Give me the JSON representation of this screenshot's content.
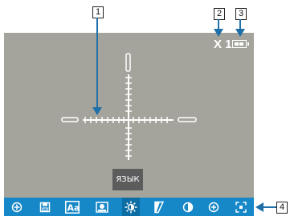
{
  "callouts": {
    "c1": "1",
    "c2": "2",
    "c3": "3",
    "c4": "4"
  },
  "status": {
    "zoom": "X 1"
  },
  "battery": {
    "level_fraction": 1.0,
    "icon": "battery-icon"
  },
  "reticle": {
    "icon": "crosshair-reticle"
  },
  "menu": {
    "active_label": "ЯЗЫК"
  },
  "toolbar": {
    "items": [
      {
        "icon": "target-icon"
      },
      {
        "icon": "save-icon"
      },
      {
        "icon": "font-icon"
      },
      {
        "icon": "picture-icon"
      },
      {
        "icon": "brightness-icon",
        "active": true
      },
      {
        "icon": "contrast-icon"
      },
      {
        "icon": "invert-icon"
      },
      {
        "icon": "zoom-in-icon"
      },
      {
        "icon": "fit-screen-icon"
      }
    ]
  },
  "colors": {
    "screen_bg": "#a5a49c",
    "toolbar_bg": "#1687c7",
    "menu_label_bg": "#5c5c5c",
    "callout_arrow": "#1f6fa8"
  }
}
